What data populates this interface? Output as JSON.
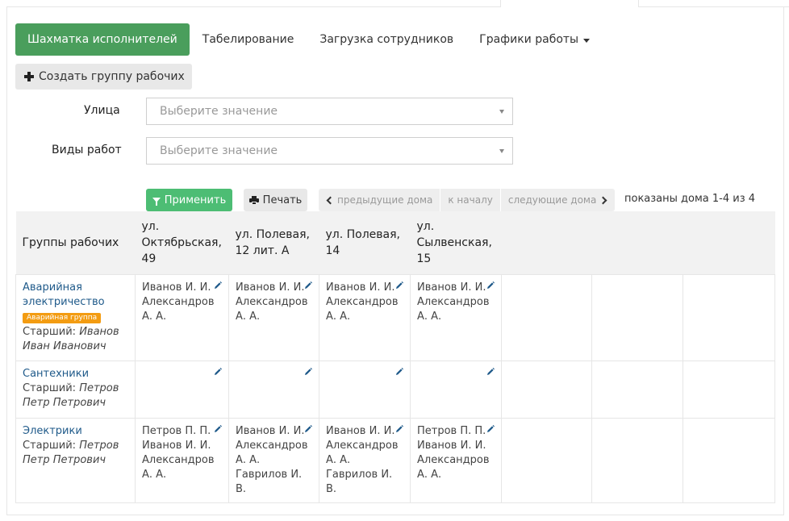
{
  "nav": {
    "tabs": [
      {
        "label": "Шахматка исполнителей",
        "active": true
      },
      {
        "label": "Табелирование"
      },
      {
        "label": "Загрузка сотрудников"
      },
      {
        "label": "Графики работы",
        "dropdown": true
      }
    ]
  },
  "actions": {
    "create_group": "Создать группу рабочих"
  },
  "filters": {
    "street": {
      "label": "Улица",
      "placeholder": "Выберите значение"
    },
    "work_types": {
      "label": "Виды работ",
      "placeholder": "Выберите значение"
    }
  },
  "toolbar": {
    "apply": "Применить",
    "print": "Печать",
    "prev_houses": "предыдущие дома",
    "to_start": "к началу",
    "next_houses": "следующие дома",
    "shown": "показаны дома 1-4 из 4"
  },
  "table": {
    "group_header": "Группы рабочих",
    "houses": [
      "ул. Октябрьская, 49",
      "ул. Полевая, 12 лит. А",
      "ул. Полевая, 14",
      "ул. Сылвенская, 15"
    ],
    "senior_label": "Старший:",
    "rows": [
      {
        "name": "Аварийная электричество",
        "badge": "Аварийная группа",
        "senior": "Иванов Иван Иванович",
        "cells": [
          [
            "Иванов И. И.",
            "Александров А. А."
          ],
          [
            "Иванов И. И.",
            "Александров А. А."
          ],
          [
            "Иванов И. И.",
            "Александров А. А."
          ],
          [
            "Иванов И. И.",
            "Александров А. А."
          ]
        ]
      },
      {
        "name": "Сантехники",
        "senior": "Петров Петр Петрович",
        "cells": [
          [],
          [],
          [],
          []
        ]
      },
      {
        "name": "Электрики",
        "senior": "Петров Петр Петрович",
        "cells": [
          [
            "Петров П. П.",
            "Иванов И. И.",
            "Александров А. А."
          ],
          [
            "Иванов И. И.",
            "Александров А. А.",
            "Гаврилов И. В."
          ],
          [
            "Иванов И. И.",
            "Александров А. А.",
            "Гаврилов И. В."
          ],
          [
            "Петров П. П.",
            "Иванов И. И.",
            "Александров А. А."
          ]
        ]
      }
    ]
  },
  "colors": {
    "active_tab": "#4a9e5c",
    "apply_button": "#4dbd74",
    "badge": "#f39c12",
    "link": "#1f5a8a"
  }
}
